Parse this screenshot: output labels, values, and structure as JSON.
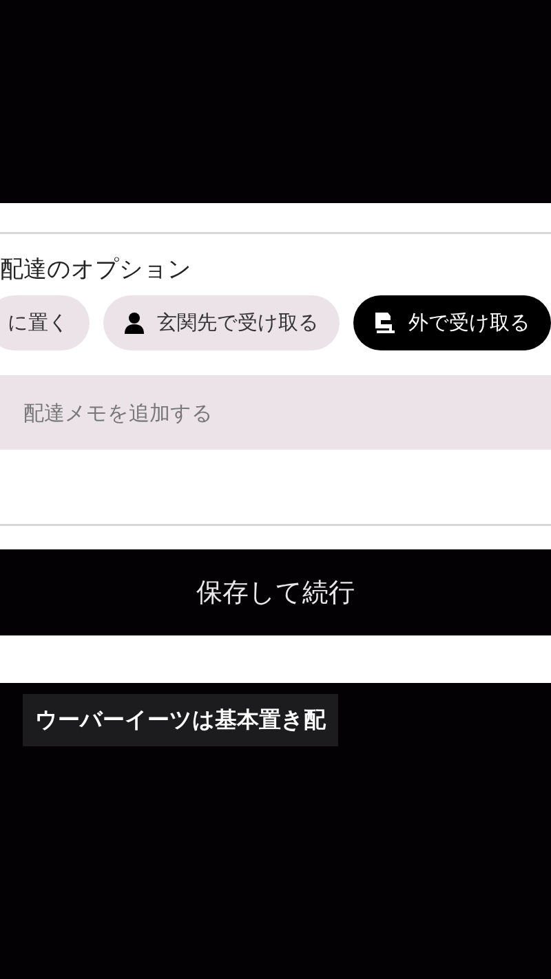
{
  "section_title": "配達のオプション",
  "options": [
    {
      "label": "に置く",
      "kind": "plain",
      "selected": false
    },
    {
      "label": "玄関先で受け取る",
      "kind": "person",
      "selected": false
    },
    {
      "label": "外で受け取る",
      "kind": "building",
      "selected": true
    }
  ],
  "memo": {
    "placeholder": "配達メモを追加する"
  },
  "save_button": "保存して続行",
  "caption": "ウーバーイーツは基本置き配"
}
